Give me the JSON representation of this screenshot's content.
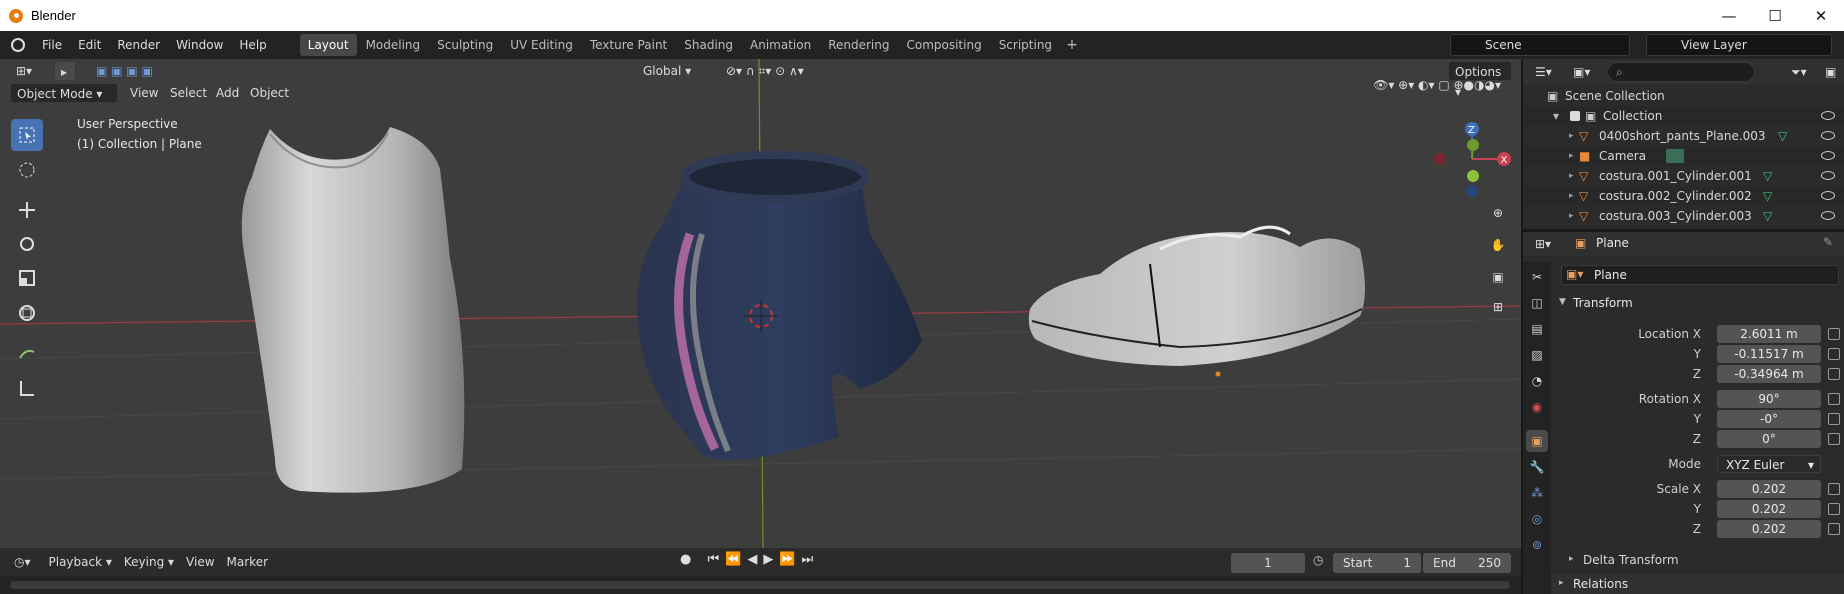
{
  "window": {
    "title": "Blender",
    "minimize": "—",
    "maximize": "☐",
    "close": "✕"
  },
  "menubar": {
    "items": [
      "File",
      "Edit",
      "Render",
      "Window",
      "Help"
    ]
  },
  "workspaces": [
    "Layout",
    "Modeling",
    "Sculpting",
    "UV Editing",
    "Texture Paint",
    "Shading",
    "Animation",
    "Rendering",
    "Compositing",
    "Scripting"
  ],
  "active_workspace": "Layout",
  "add_workspace": "+",
  "scene": {
    "name": "Scene",
    "view_layer": "View Layer"
  },
  "viewport": {
    "mode": "Object Mode",
    "menus": [
      "View",
      "Select",
      "Add",
      "Object"
    ],
    "orientation": "Global",
    "options": "Options",
    "overlay_title": "User Perspective",
    "overlay_subtitle": "(1) Collection | Plane",
    "gizmo_labels": {
      "z": "Z",
      "x": "X"
    },
    "colors": {
      "bg": "#3d3d3d",
      "grid": "#484848",
      "x_axis": "#9a3b46",
      "y_axis": "#6f8e2a"
    }
  },
  "timeline": {
    "menus": [
      "Playback",
      "Keying",
      "View",
      "Marker"
    ],
    "current_frame": "1",
    "start_label": "Start",
    "start": "1",
    "end_label": "End",
    "end": "250"
  },
  "outliner": {
    "search_placeholder": "",
    "scene_collection": "Scene Collection",
    "collection": "Collection",
    "items": [
      {
        "name": "0400short_pants_Plane.003",
        "type": "mesh"
      },
      {
        "name": "Camera",
        "type": "camera"
      },
      {
        "name": "costura.001_Cylinder.001",
        "type": "mesh"
      },
      {
        "name": "costura.002_Cylinder.002",
        "type": "mesh"
      },
      {
        "name": "costura.003_Cylinder.003",
        "type": "mesh"
      }
    ]
  },
  "properties": {
    "object_name": "Plane",
    "data_name": "Plane",
    "transform_label": "Transform",
    "location": {
      "label": "Location X",
      "x": "2.6011 m",
      "y": "-0.11517 m",
      "z": "-0.34964 m"
    },
    "rotation": {
      "label": "Rotation X",
      "x": "90°",
      "y": "-0°",
      "z": "0°"
    },
    "mode_label": "Mode",
    "mode": "XYZ Euler",
    "scale": {
      "label": "Scale X",
      "x": "0.202",
      "y": "0.202",
      "z": "0.202"
    },
    "axis_y": "Y",
    "axis_z": "Z",
    "delta_transform": "Delta Transform",
    "relations": "Relations"
  },
  "accent_color": "#4772b3",
  "icons": [
    "blender-logo-icon",
    "select-box-icon",
    "cursor-icon",
    "move-icon",
    "rotate-icon",
    "scale-icon",
    "transform-icon",
    "annotate-icon",
    "measure-icon",
    "zoom-icon",
    "hand-icon",
    "camera-icon",
    "grid-icon",
    "eye-icon",
    "lock-icon",
    "wrench-icon",
    "object-icon"
  ]
}
